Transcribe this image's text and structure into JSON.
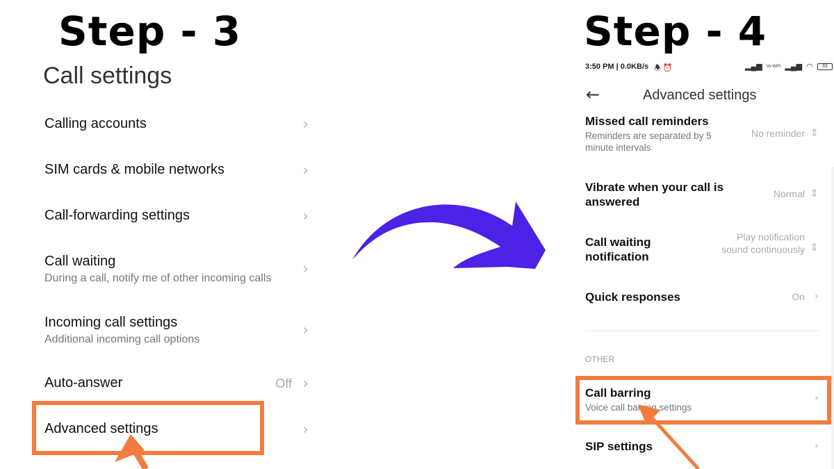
{
  "steps": {
    "left": "Step - 3",
    "right": "Step - 4"
  },
  "colors": {
    "highlight": "#f27c3f",
    "arrow": "#4b22e6"
  },
  "call_settings": {
    "title": "Call settings",
    "items": [
      {
        "title": "Calling accounts",
        "subtitle": "",
        "value": ""
      },
      {
        "title": "SIM cards & mobile networks",
        "subtitle": "",
        "value": ""
      },
      {
        "title": "Call-forwarding settings",
        "subtitle": "",
        "value": ""
      },
      {
        "title": "Call waiting",
        "subtitle": "During a call, notify me of other incoming calls",
        "value": ""
      },
      {
        "title": "Incoming call settings",
        "subtitle": "Additional incoming call options",
        "value": ""
      },
      {
        "title": "Auto-answer",
        "subtitle": "",
        "value": "Off"
      },
      {
        "title": "Advanced settings",
        "subtitle": "",
        "value": ""
      }
    ]
  },
  "status_bar": {
    "time_info": "3:50 PM | 0.0KB/s",
    "icons": [
      "alarm-off-icon",
      "alarm-icon",
      "signal-icon",
      "volte-icon",
      "signal-icon",
      "wifi-icon",
      "battery-icon"
    ],
    "battery": "33",
    "volte": "Vo WiFi"
  },
  "advanced_settings": {
    "title": "Advanced settings",
    "items": [
      {
        "title": "Missed call reminders",
        "subtitle": "Reminders are separated by 5 minute intervals",
        "value": "No reminder"
      },
      {
        "title": "Vibrate when your call is answered",
        "subtitle": "",
        "value": "Normal"
      },
      {
        "title": "Call waiting notification",
        "subtitle": "",
        "value": "Play notification sound continuously"
      },
      {
        "title": "Quick responses",
        "subtitle": "",
        "value": "On"
      }
    ],
    "section_other": "OTHER",
    "other_items": [
      {
        "title": "Call barring",
        "subtitle": "Voice call barring settings"
      },
      {
        "title": "SIP settings",
        "subtitle": ""
      }
    ]
  }
}
